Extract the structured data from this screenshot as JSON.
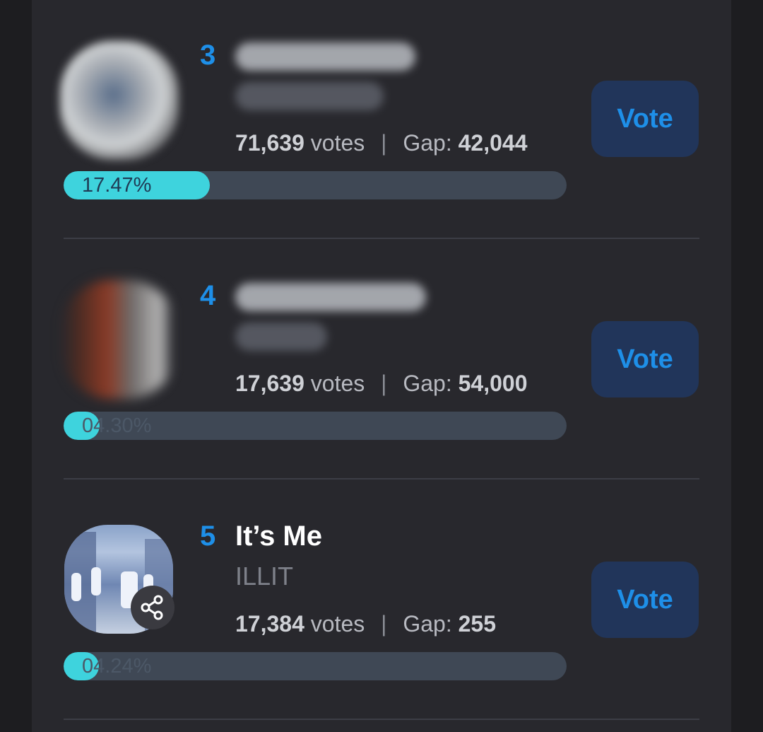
{
  "entries": [
    {
      "rank": "3",
      "title": "",
      "artist": "",
      "votes_value": "71,639",
      "votes_label": "votes",
      "separator": "|",
      "gap_label": "Gap:",
      "gap_value": "42,044",
      "vote_label": "Vote",
      "percent_text": "17.47%",
      "percent": 17.47
    },
    {
      "rank": "4",
      "title": "",
      "artist": "",
      "votes_value": "17,639",
      "votes_label": "votes",
      "separator": "|",
      "gap_label": "Gap:",
      "gap_value": "54,000",
      "vote_label": "Vote",
      "percent_text": "04.30%",
      "percent": 4.3
    },
    {
      "rank": "5",
      "title": "It’s Me",
      "artist": "ILLIT",
      "votes_value": "17,384",
      "votes_label": "votes",
      "separator": "|",
      "gap_label": "Gap:",
      "gap_value": "255",
      "vote_label": "Vote",
      "percent_text": "04.24%",
      "percent": 4.24
    }
  ],
  "icons": {
    "share": "share-icon"
  },
  "colors": {
    "accent": "#1e8fe8",
    "progress_fill": "#3ed3dd",
    "vote_button_bg": "#21355a"
  }
}
